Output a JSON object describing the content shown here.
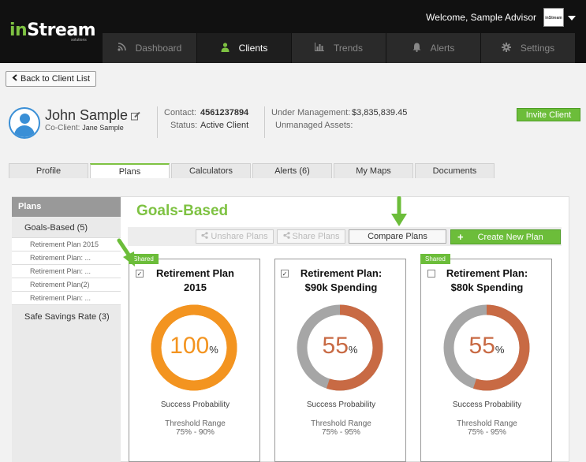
{
  "brand": {
    "logo_in": "in",
    "logo_stream": "Stream",
    "logo_sub": "solutions",
    "avatar_text": "inStream"
  },
  "header": {
    "welcome": "Welcome, Sample Advisor"
  },
  "nav": {
    "items": [
      {
        "label": "Dashboard",
        "icon": "rss-icon"
      },
      {
        "label": "Clients",
        "icon": "user-icon"
      },
      {
        "label": "Trends",
        "icon": "bar-chart-icon"
      },
      {
        "label": "Alerts",
        "icon": "bell-icon"
      },
      {
        "label": "Settings",
        "icon": "gear-icon"
      }
    ]
  },
  "back_label": "Back to Client List",
  "client": {
    "name": "John Sample",
    "coclient_label": "Co-Client:",
    "coclient": "Jane Sample",
    "contact_label": "Contact:",
    "contact": "4561237894",
    "status_label": "Status:",
    "status": "Active Client",
    "under_mgmt_label": "Under Management:",
    "under_mgmt": "$3,835,839.45",
    "unmanaged_label": "Unmanaged Assets:",
    "invite_label": "Invite Client"
  },
  "tabs": [
    "Profile",
    "Plans",
    "Calculators",
    "Alerts (6)",
    "My Maps",
    "Documents"
  ],
  "sidebar": {
    "header": "Plans",
    "groups": [
      {
        "label": "Goals-Based (5)"
      },
      {
        "label": "Safe Savings Rate (3)"
      }
    ],
    "subitems": [
      "Retirement Plan 2015",
      "Retirement Plan: ...",
      "Retirement Plan: ...",
      "Retirement Plan(2)",
      "Retirement Plan: ..."
    ]
  },
  "section_title": "Goals-Based",
  "toolbar": {
    "unshare": "Unshare Plans",
    "share": "Share Plans",
    "compare": "Compare Plans",
    "create": "Create New Plan"
  },
  "cards": [
    {
      "shared": "Shared",
      "checked": "✓",
      "title1": "Retirement Plan",
      "title2": "2015",
      "percent": "100",
      "probability": 1.0,
      "color": "#f39420",
      "track": "#f39420",
      "sign": "%",
      "success": "Success Probability",
      "threshold_label": "Threshold Range",
      "threshold": "75% - 90%"
    },
    {
      "shared": "",
      "checked": "✓",
      "title1": "Retirement Plan:",
      "title2": "$90k Spending",
      "percent": "55",
      "probability": 0.55,
      "color": "#c86a44",
      "track": "#a6a6a6",
      "sign": "%",
      "success": "Success Probability",
      "threshold_label": "Threshold Range",
      "threshold": "75% - 95%"
    },
    {
      "shared": "Shared",
      "checked": "",
      "title1": "Retirement Plan:",
      "title2": "$80k Spending",
      "percent": "55",
      "probability": 0.55,
      "color": "#c86a44",
      "track": "#a6a6a6",
      "sign": "%",
      "success": "Success Probability",
      "threshold_label": "Threshold Range",
      "threshold": "75% - 95%"
    }
  ],
  "colors": {
    "accent": "#7ec242",
    "button_green": "#6cbd3a",
    "orange": "#f39420",
    "rust": "#c86a44",
    "gray_track": "#a6a6a6"
  }
}
